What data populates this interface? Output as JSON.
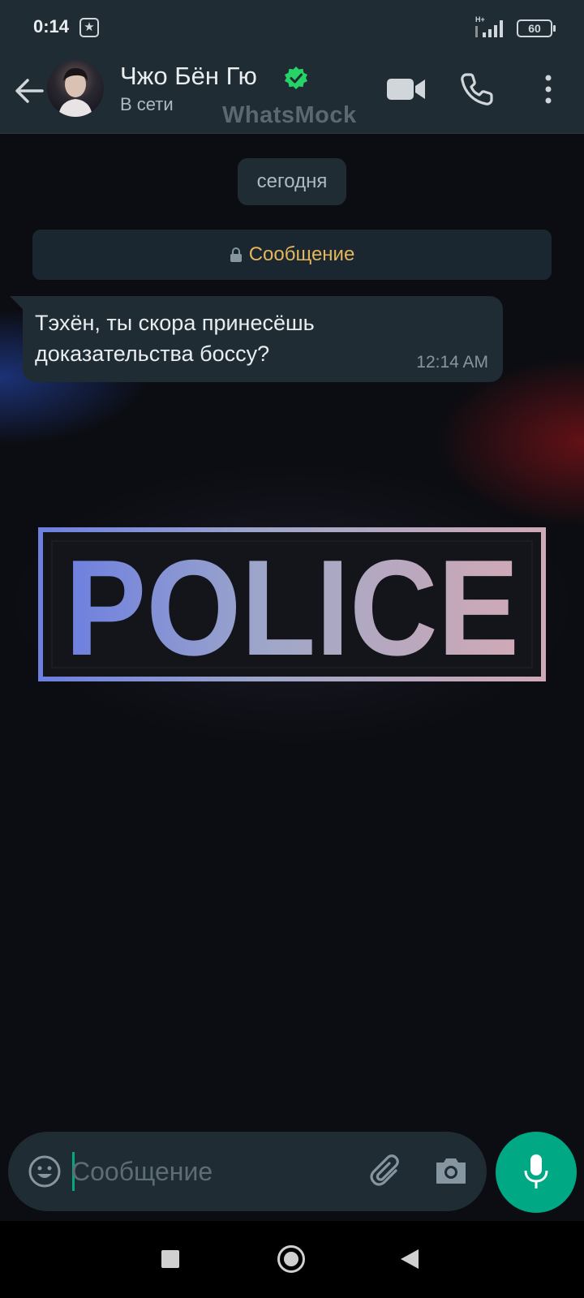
{
  "status_bar": {
    "time": "0:14",
    "network": "H+",
    "battery": "60"
  },
  "header": {
    "contact_name": "Чжо Бён Гю",
    "status": "В сети",
    "watermark": "WhatsMock",
    "icons": [
      "back-arrow-icon",
      "avatar",
      "verified-icon",
      "video-call-icon",
      "voice-call-icon",
      "more-vert-icon"
    ],
    "verified_color": "#25d366"
  },
  "chat": {
    "date_label": "сегодня",
    "encryption_banner": "Сообщение",
    "messages": [
      {
        "direction": "incoming",
        "text": "Тэхён, ты скора принесёшь доказательства боссу?",
        "time": "12:14 AM"
      }
    ],
    "wallpaper_sign": "POLICE"
  },
  "input_bar": {
    "placeholder": "Сообщение",
    "value": "",
    "icons": [
      "emoji-icon",
      "attach-icon",
      "camera-icon",
      "mic-icon"
    ],
    "accent_color": "#00a884"
  },
  "nav_bar": {
    "icons": [
      "recents-icon",
      "home-icon",
      "back-icon"
    ]
  }
}
